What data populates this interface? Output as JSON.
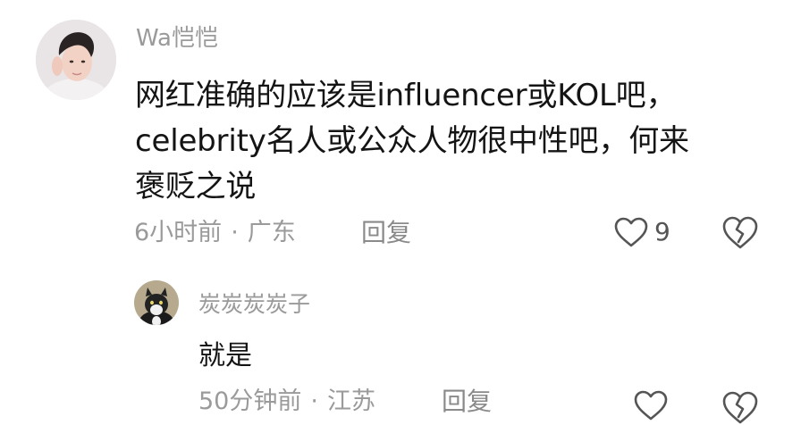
{
  "comment": {
    "username": "Wa恺恺",
    "content_lines": [
      "网红准确的应该是influencer或KOL吧，",
      "celebrity名人或公众人物很中性吧，何来",
      "褒贬之说"
    ],
    "time": "6小时前",
    "separator": "·",
    "location": "广东",
    "reply_label": "回复",
    "like_count": "9",
    "like_icon": "heart-outline-icon",
    "dislike_icon": "broken-heart-icon"
  },
  "reply": {
    "username": "炭炭炭炭子",
    "content": "就是",
    "time": "50分钟前",
    "separator": "·",
    "location": "江苏",
    "reply_label": "回复",
    "like_icon": "heart-outline-icon",
    "dislike_icon": "broken-heart-icon"
  },
  "colors": {
    "text_primary": "#141414",
    "text_secondary": "#9a9a9a",
    "icon": "#555555",
    "background": "#ffffff"
  }
}
